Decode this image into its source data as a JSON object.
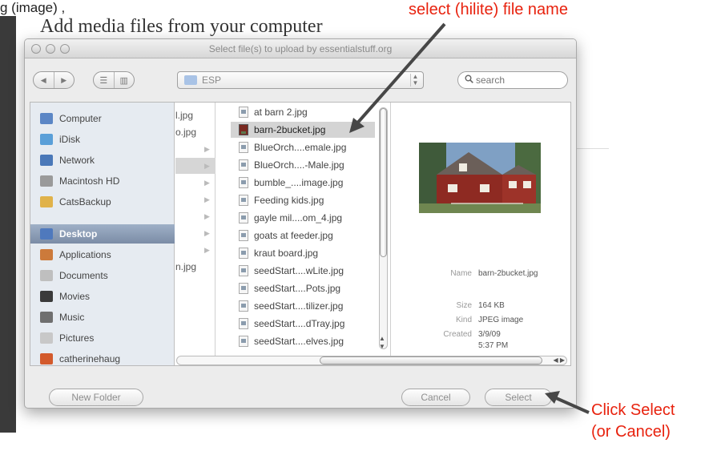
{
  "page": {
    "top_fragment": "g (image)   ,",
    "heading": "Add media files from your computer"
  },
  "annotations": {
    "select_hint": "select (hilite) file name",
    "click_select_line1": "Click Select",
    "click_select_line2": "(or Cancel)",
    "color": "#e8220e"
  },
  "dialog": {
    "title": "Select file(s) to upload by essentialstuff.org",
    "toolbar": {
      "back_icon": "back-arrow-icon",
      "forward_icon": "forward-arrow-icon",
      "view_list_icon": "list-view-icon",
      "view_columns_icon": "column-view-icon",
      "location": "ESP",
      "search_placeholder": "search"
    },
    "sidebar": [
      {
        "label": "Computer",
        "icon": "computer-icon",
        "color": "#5b86c5"
      },
      {
        "label": "iDisk",
        "icon": "idisk-icon",
        "color": "#5a9fd8"
      },
      {
        "label": "Network",
        "icon": "network-icon",
        "color": "#4a78b8"
      },
      {
        "label": "Macintosh HD",
        "icon": "hard-drive-icon",
        "color": "#9a9a9a"
      },
      {
        "label": "CatsBackup",
        "icon": "external-drive-icon",
        "color": "#e0b24a"
      },
      {
        "label": "Desktop",
        "icon": "desktop-icon",
        "color": "#4f79bd",
        "selected": true
      },
      {
        "label": "Applications",
        "icon": "applications-icon",
        "color": "#cc7a3b"
      },
      {
        "label": "Documents",
        "icon": "documents-icon",
        "color": "#bfbfbf"
      },
      {
        "label": "Movies",
        "icon": "movies-icon",
        "color": "#3a3a3a"
      },
      {
        "label": "Music",
        "icon": "music-icon",
        "color": "#6f6f6f"
      },
      {
        "label": "Pictures",
        "icon": "pictures-icon",
        "color": "#c8c8c8"
      },
      {
        "label": "catherinehaug",
        "icon": "home-icon",
        "color": "#d35a2c"
      }
    ],
    "column_a": [
      {
        "text": "l.jpg"
      },
      {
        "text": "o.jpg"
      },
      {
        "text": ""
      },
      {
        "text": "",
        "highlight": true
      },
      {
        "text": ""
      },
      {
        "text": ""
      },
      {
        "text": ""
      },
      {
        "text": ""
      },
      {
        "text": ""
      },
      {
        "text": "n.jpg"
      }
    ],
    "files": [
      {
        "name": "at barn 2.jpg"
      },
      {
        "name": "barn-2bucket.jpg",
        "selected": true,
        "thumb": true
      },
      {
        "name": "BlueOrch....emale.jpg"
      },
      {
        "name": "BlueOrch....-Male.jpg"
      },
      {
        "name": "bumble_....image.jpg"
      },
      {
        "name": "Feeding kids.jpg"
      },
      {
        "name": "gayle mil....om_4.jpg"
      },
      {
        "name": "goats at feeder.jpg"
      },
      {
        "name": "kraut board.jpg"
      },
      {
        "name": "seedStart....wLite.jpg"
      },
      {
        "name": "seedStart....Pots.jpg"
      },
      {
        "name": "seedStart....tilizer.jpg"
      },
      {
        "name": "seedStart....dTray.jpg"
      },
      {
        "name": "seedStart....elves.jpg"
      }
    ],
    "preview": {
      "name_label": "Name",
      "name_value": "barn-2bucket.jpg",
      "size_label": "Size",
      "size_value": "164 KB",
      "kind_label": "Kind",
      "kind_value": "JPEG image",
      "created_label": "Created",
      "created_value_1": "3/9/09",
      "created_value_2": "5:37 PM"
    },
    "buttons": {
      "new_folder": "New Folder",
      "cancel": "Cancel",
      "select": "Select"
    }
  }
}
